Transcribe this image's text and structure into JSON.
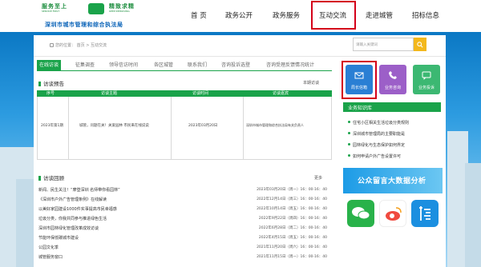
{
  "header": {
    "logo_slogan_left": "服务至上",
    "logo_slogan_left_en": "SERVICE FIRST",
    "logo_slogan_right": "精致求精",
    "logo_slogan_right_en": "KEEP IMPROVING",
    "logo_org": "深圳市城市管理和综合执法局"
  },
  "nav": [
    {
      "label": "首 页"
    },
    {
      "label": "政务公开"
    },
    {
      "label": "政务服务"
    },
    {
      "label": "互动交流"
    },
    {
      "label": "走进城管"
    },
    {
      "label": "招标信息"
    }
  ],
  "breadcrumb": {
    "prefix": "您的位置：",
    "home": "首页",
    "sep": ">",
    "current": "互动交流"
  },
  "search": {
    "placeholder": "请输入关键词"
  },
  "tabs": [
    {
      "label": "在线访谈"
    },
    {
      "label": "征集调查"
    },
    {
      "label": "领导信访时间"
    },
    {
      "label": "各区城管"
    },
    {
      "label": "联系我们"
    },
    {
      "label": "咨询投诉选登"
    },
    {
      "label": "咨询受理反馈情况统计"
    }
  ],
  "preview": {
    "title": "访谈预告",
    "more": "本期访谈",
    "headers": [
      "序号",
      "访谈主题",
      "访谈时间",
      "访谈嘉宾"
    ],
    "row": [
      "2023年第1期",
      "城管，问题在关！关爱园林 市民来在线说说",
      "2023年03月20日",
      "深圳市城市管理和综合执法局有关负责人"
    ]
  },
  "review": {
    "title": "访谈回顾",
    "more": "更多",
    "items": [
      {
        "title": "新闻、民生关注！“摩登深圳 名师带你看园林”",
        "date": "2023年03月20日（周一）16：00-16：40"
      },
      {
        "title": "《深圳市户外广告管理条例》在线解读",
        "date": "2022年12月14日（周三）16：00-16：40"
      },
      {
        "title": "以美好家园建设1000件实事提高市民幸福感",
        "date": "2022年10月14日（周五）16：00-16：40"
      },
      {
        "title": "垃圾分类，你我共同参与推进绿色生活",
        "date": "2022年9月22日（周四）16：00-16：40"
      },
      {
        "title": "深圳市园林绿化管理改革成效访谈",
        "date": "2022年6月28日（周二）16：00-16：40"
      },
      {
        "title": "节能环保低碳城市建设",
        "date": "2022年4月15日（周五）16：00-16：40"
      },
      {
        "title": "公园文化季",
        "date": "2021年11月20日（周六）16：00-16：40"
      },
      {
        "title": "城管服务窗口",
        "date": "2021年11月15日（周一）16：00-16：40"
      }
    ]
  },
  "quick": [
    {
      "label": "局长信箱",
      "color": "#2a7fd4",
      "icon": "mail-icon"
    },
    {
      "label": "业务咨询",
      "color": "#9c5fc8",
      "icon": "phone-icon"
    },
    {
      "label": "业务投诉",
      "color": "#3cb872",
      "icon": "complaint-icon"
    }
  ],
  "knowledge": {
    "title": "业务知识库",
    "items": [
      "住宅小区相关生活垃圾分类规则",
      "深圳城市管理局的主要职能是",
      "园林绿化与生态保护如何界定",
      "如何申请户外广告设置许可"
    ]
  },
  "ad": {
    "text": "公众留言大数据分析"
  },
  "social": [
    {
      "name": "wechat-icon",
      "color": "#29b24a"
    },
    {
      "name": "weibo-icon",
      "color": "#f04a3f"
    },
    {
      "name": "app-icon",
      "color": "#1b8fe0"
    }
  ]
}
